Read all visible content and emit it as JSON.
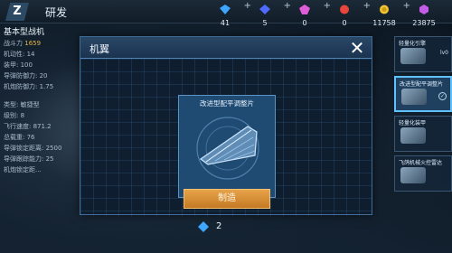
{
  "header": {
    "title": "研发",
    "resources": [
      {
        "icon": "blue-diamond-icon",
        "value": "41",
        "color": "#3fa6ff"
      },
      {
        "icon": "blue-gem-icon",
        "value": "5",
        "color": "#4f6bff"
      },
      {
        "icon": "pink-gem-icon",
        "value": "0",
        "color": "#e05dd8"
      },
      {
        "icon": "red-gem-icon",
        "value": "0",
        "color": "#e8453c"
      },
      {
        "icon": "gold-coin-icon",
        "value": "11758",
        "color": "#f1c232"
      },
      {
        "icon": "purple-crystal-icon",
        "value": "23875",
        "color": "#c45ce8"
      }
    ]
  },
  "aircraft": {
    "name": "基本型战机",
    "power_label": "战斗力",
    "power_value": "1659",
    "stats_top": [
      "机动性: 14",
      "装甲: 100",
      "导弹防御力: 20",
      "机炮防御力: 1.75"
    ],
    "stats_bottom": [
      "类型: 敏捷型",
      "级别: 8",
      "飞行速度: 871.2",
      "总载重: 76",
      "导弹锁定距离: 2500",
      "导弹跟踪能力: 25",
      "机炮锁定距..."
    ]
  },
  "parts": [
    {
      "label": "轻量化引擎",
      "badge": "lv0",
      "selected": false
    },
    {
      "label": "改进型配平调整片",
      "badge": "✓",
      "selected": true
    },
    {
      "label": "轻量化装甲",
      "badge": "",
      "selected": false
    },
    {
      "label": "飞鸽机械火控雷达",
      "badge": "",
      "selected": false
    }
  ],
  "modal": {
    "title": "机翼",
    "close_symbol": "✕",
    "item_name": "改进型配平调整片",
    "cost_value": "2",
    "build_label": "制造",
    "accent_color": "#5fc2ff",
    "button_color": "#d98e33"
  }
}
